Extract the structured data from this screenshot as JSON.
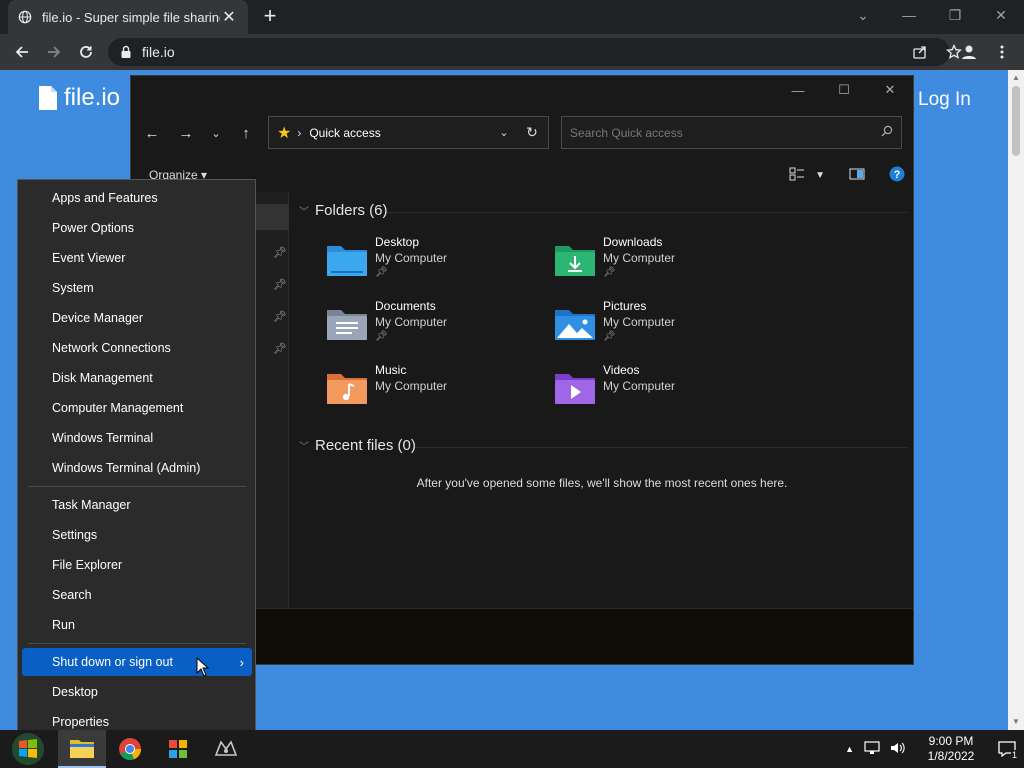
{
  "browser": {
    "tab_title": "file.io - Super simple file sharing",
    "url": "file.io"
  },
  "site": {
    "logo_text": "file.io",
    "login_label": "Log In"
  },
  "explorer": {
    "location": "Quick access",
    "search_placeholder": "Search Quick access",
    "organize_label": "Organize",
    "folders_heading": "Folders (6)",
    "recent_heading": "Recent files (0)",
    "recent_empty_message": "After you've opened some files, we'll show the most recent ones here.",
    "folders": [
      {
        "name": "Desktop",
        "sub": "My Computer",
        "pinned": true,
        "icon": "desktop-folder-icon",
        "color": "#3aa0e8"
      },
      {
        "name": "Downloads",
        "sub": "My Computer",
        "pinned": true,
        "icon": "downloads-folder-icon",
        "color": "#2bb673"
      },
      {
        "name": "Documents",
        "sub": "My Computer",
        "pinned": true,
        "icon": "documents-folder-icon",
        "color": "#8e9aab"
      },
      {
        "name": "Pictures",
        "sub": "My Computer",
        "pinned": true,
        "icon": "pictures-folder-icon",
        "color": "#2f8fe3"
      },
      {
        "name": "Music",
        "sub": "My Computer",
        "pinned": false,
        "icon": "music-folder-icon",
        "color": "#f08a4b"
      },
      {
        "name": "Videos",
        "sub": "My Computer",
        "pinned": false,
        "icon": "videos-folder-icon",
        "color": "#9b5de5"
      }
    ]
  },
  "winx_menu": {
    "items": [
      "Apps and Features",
      "Power Options",
      "Event Viewer",
      "System",
      "Device Manager",
      "Network Connections",
      "Disk Management",
      "Computer Management",
      "Windows Terminal",
      "Windows Terminal (Admin)",
      "Task Manager",
      "Settings",
      "File Explorer",
      "Search",
      "Run",
      "Shut down or sign out",
      "Desktop",
      "Properties"
    ],
    "active_item": "Shut down or sign out",
    "accent_color": "#0a5fc4"
  },
  "taskbar": {
    "time": "9:00 PM",
    "date": "1/8/2022",
    "notification_count": "1"
  }
}
